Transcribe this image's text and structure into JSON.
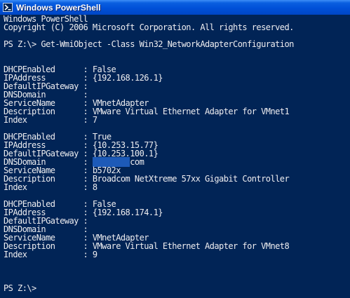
{
  "window": {
    "title": "Windows PowerShell",
    "icon": "powershell-icon"
  },
  "console": {
    "background": "#012456",
    "foreground": "#eeedf0",
    "lines": [
      "Windows PowerShell",
      "Copyright (C) 2006 Microsoft Corporation. All rights reserved.",
      "",
      "PS Z:\\> Get-WmiObject -Class Win32_NetworkAdapterConfiguration",
      "",
      "",
      "DHCPEnabled      : False",
      "IPAddress        : {192.168.126.1}",
      "DefaultIPGateway :",
      "DNSDomain        :",
      "ServiceName      : VMnetAdapter",
      "Description      : VMware Virtual Ethernet Adapter for VMnet1",
      "Index            : 7",
      "",
      "DHCPEnabled      : True",
      "IPAddress        : {10.253.15.77}",
      "DefaultIPGateway : {10.253.100.1}",
      "DNSDomain        : ",
      "ServiceName      : b5702x",
      "Description      : Broadcom NetXtreme 57xx Gigabit Controller",
      "Index            : 8",
      "",
      "DHCPEnabled      : False",
      "IPAddress        : {192.168.174.1}",
      "DefaultIPGateway :",
      "DNSDomain        :",
      "ServiceName      : VMnetAdapter",
      "Description      : VMware Virtual Ethernet Adapter for VMnet8",
      "Index            : 9",
      "",
      "",
      "",
      "PS Z:\\>"
    ],
    "dns_domain_redacted_suffix": "com"
  }
}
